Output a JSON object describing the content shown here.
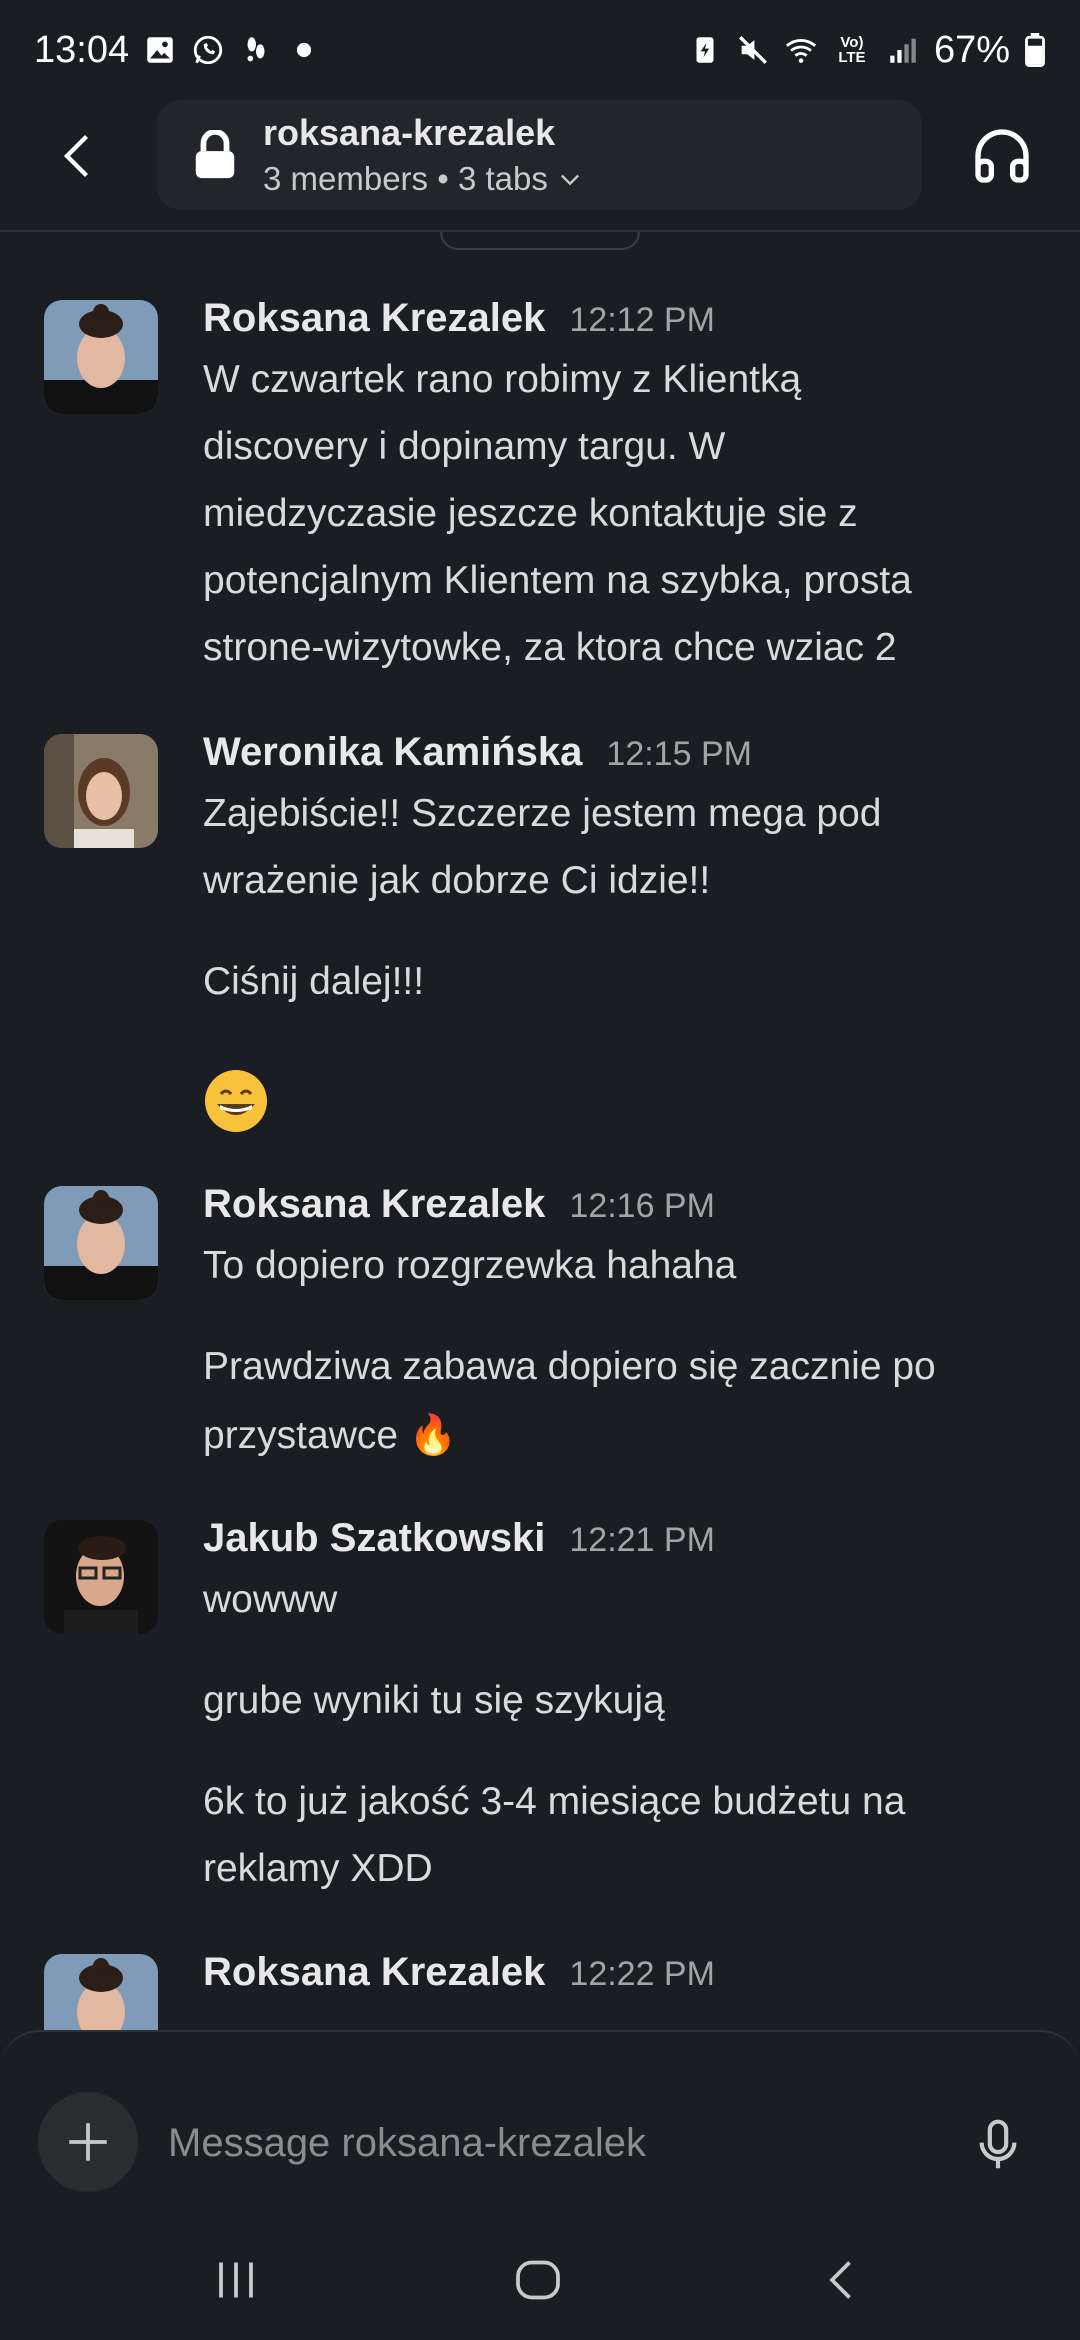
{
  "status_bar": {
    "time": "13:04",
    "battery_percent": "67%",
    "left_icons": [
      "gallery-icon",
      "whatsapp-icon",
      "footsteps-icon",
      "dot-icon"
    ],
    "right_icons": [
      "battery-saver-icon",
      "mute-icon",
      "wifi-icon",
      "volte-icon",
      "signal-icon",
      "battery-icon"
    ],
    "volte_label": "Vo) LTE"
  },
  "header": {
    "channel_name": "roksana-krezalek",
    "subtitle": "3 members • 3 tabs"
  },
  "messages": [
    {
      "author": "Roksana Krezalek",
      "time": "12:12 PM",
      "lines": [
        "W czwartek rano robimy z Klientką",
        "discovery i dopinamy targu. W",
        "miedzyczasie jeszcze kontaktuje sie z",
        "potencjalnym Klientem na szybka, prosta",
        "strone-wizytowke, za ktora chce wziac 2"
      ]
    },
    {
      "author": "Weronika Kamińska",
      "time": "12:15 PM",
      "lines": [
        "Zajebiście!! Szczerze jestem mega pod",
        "wrażenie jak dobrze Ci idzie!!",
        "Ciśnij dalej!!!"
      ],
      "emoji": "😁"
    },
    {
      "author": "Roksana Krezalek",
      "time": "12:16 PM",
      "lines": [
        "To dopiero rozgrzewka hahaha",
        "Prawdziwa zabawa dopiero się zacznie po",
        "przystawce 🔥"
      ]
    },
    {
      "author": "Jakub Szatkowski",
      "time": "12:21 PM",
      "lines": [
        "wowww",
        "grube wyniki tu się szykują",
        "6k to już jakość 3-4 miesiące budżetu na",
        "reklamy XDD"
      ]
    },
    {
      "author": "Roksana Krezalek",
      "time": "12:22 PM",
      "lines": []
    }
  ],
  "composer": {
    "placeholder": "Message roksana-krezalek"
  },
  "colors": {
    "background": "#1a1d21",
    "text": "#d9dadb",
    "muted": "#a3a4a6"
  }
}
